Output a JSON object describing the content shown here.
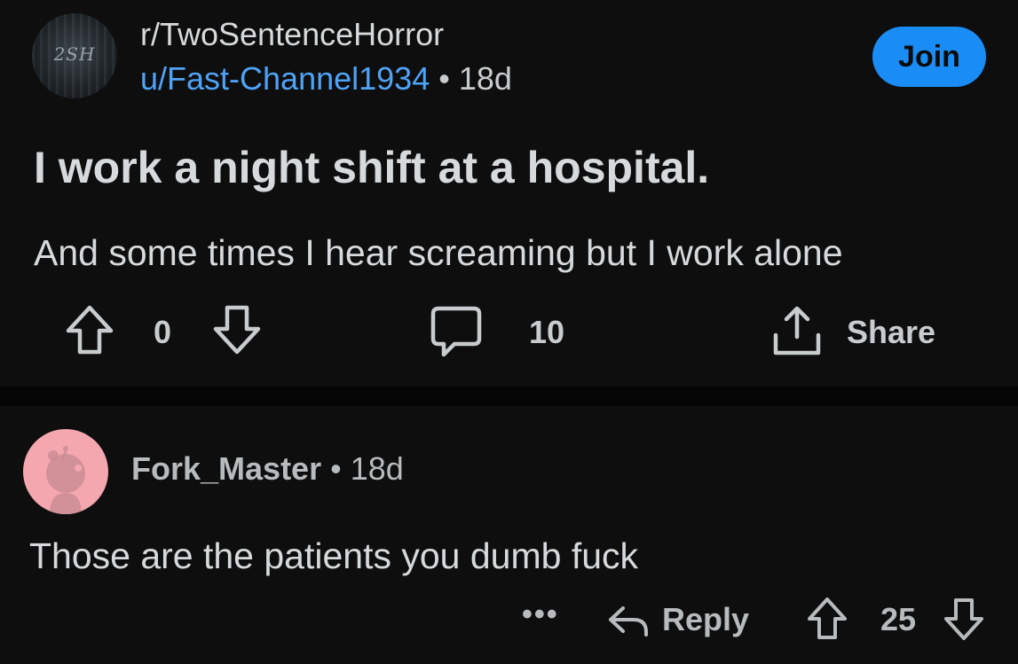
{
  "post": {
    "subreddit": "r/TwoSentenceHorror",
    "avatar_text": "2SH",
    "author": "u/Fast-Channel1934",
    "separator": "•",
    "age": "18d",
    "join_label": "Join",
    "title": "I work a night shift at a hospital.",
    "body": "And some times I hear screaming but I work alone",
    "vote_count": "0",
    "comment_count": "10",
    "share_label": "Share"
  },
  "comment": {
    "author": "Fork_Master",
    "separator": "•",
    "age": "18d",
    "body": "Those are the patients you dumb fuck",
    "more_label": "•••",
    "reply_label": "Reply",
    "vote_count": "25"
  },
  "colors": {
    "background": "#0e0e0e",
    "accent": "#1a8cf5",
    "username": "#4fa3f7",
    "comment_avatar": "#f4a7ae"
  },
  "icons": [
    "upvote-icon",
    "downvote-icon",
    "comment-icon",
    "share-icon",
    "reply-icon",
    "more-icon",
    "snoo-avatar-icon"
  ]
}
